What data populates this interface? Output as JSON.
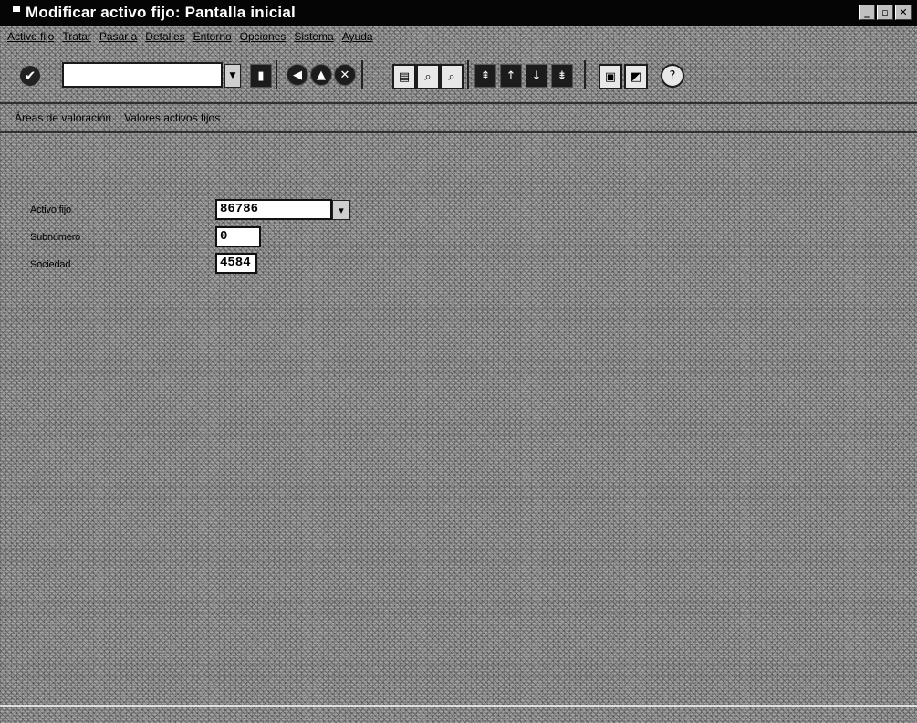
{
  "window": {
    "title": "Modificar activo fijo: Pantalla inicial",
    "minimize": "_",
    "restore": "▫",
    "close": "✕"
  },
  "menubar": {
    "items": [
      "Activo fijo",
      "Tratar",
      "Pasar a",
      "Detalles",
      "Entorno",
      "Opciones",
      "Sistema",
      "Ayuda"
    ]
  },
  "toolbar": {
    "enter_icon": "✔",
    "command_field_value": "",
    "icons": [
      "save-icon",
      "back-icon",
      "exit-icon",
      "cancel-icon",
      "print-icon",
      "find-icon",
      "find-next-icon",
      "first-page-icon",
      "previous-page-icon",
      "next-page-icon",
      "last-page-icon",
      "create-session-icon",
      "shortcut-icon",
      "help-icon"
    ]
  },
  "apptoolbar": {
    "items": [
      "Áreas de valoración",
      "Valores activos fijos"
    ]
  },
  "form": {
    "activo_fijo_label": "Activo fijo",
    "activo_fijo_value": "86786",
    "subnumero_label": "Subnúmero",
    "subnumero_value": "0",
    "sociedad_label": "Sociedad",
    "sociedad_value": "4584"
  }
}
